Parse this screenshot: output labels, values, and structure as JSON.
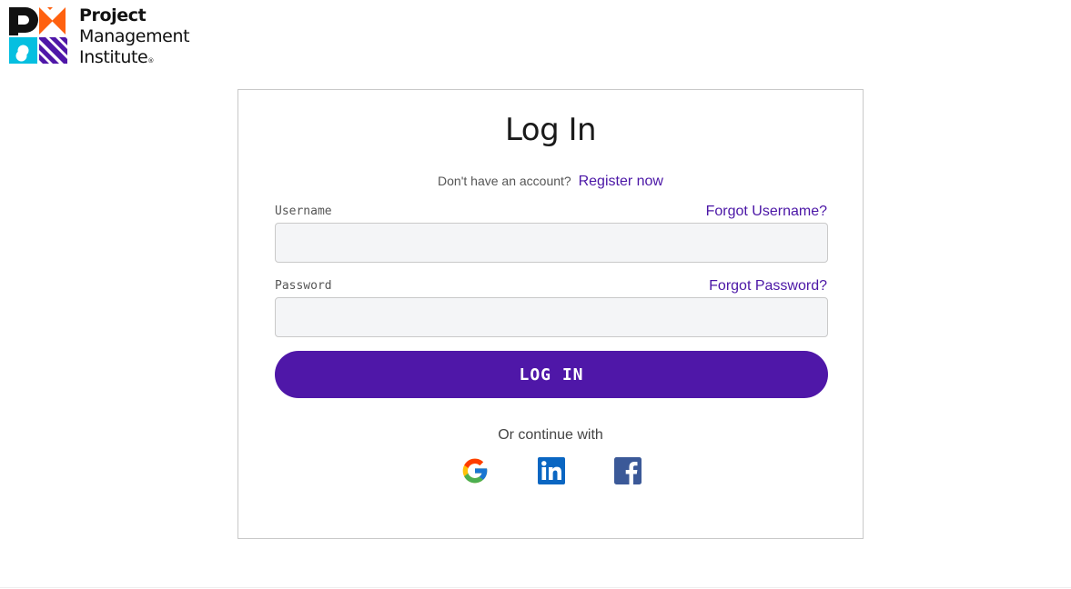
{
  "brand": {
    "line1": "Project",
    "line2": "Management",
    "line3": "Institute",
    "registered": "®",
    "colors": {
      "orange": "#ff610f",
      "purple": "#4f17a8",
      "cyan": "#05bfe0",
      "black": "#111111"
    }
  },
  "login": {
    "title": "Log In",
    "no_account_text": "Don't have an account?",
    "register_link": "Register now",
    "username_label": "Username",
    "forgot_username": "Forgot Username?",
    "username_value": "",
    "password_label": "Password",
    "forgot_password": "Forgot Password?",
    "password_value": "",
    "submit_label": "LOG IN",
    "continue_with": "Or continue with",
    "social": [
      {
        "name": "google",
        "icon": "google-icon"
      },
      {
        "name": "linkedin",
        "icon": "linkedin-icon"
      },
      {
        "name": "facebook",
        "icon": "facebook-icon"
      }
    ]
  },
  "colors": {
    "accent": "#4f17a8",
    "link": "#4b16a6",
    "input_bg": "#f4f5f7",
    "border": "#c9c9c9"
  }
}
